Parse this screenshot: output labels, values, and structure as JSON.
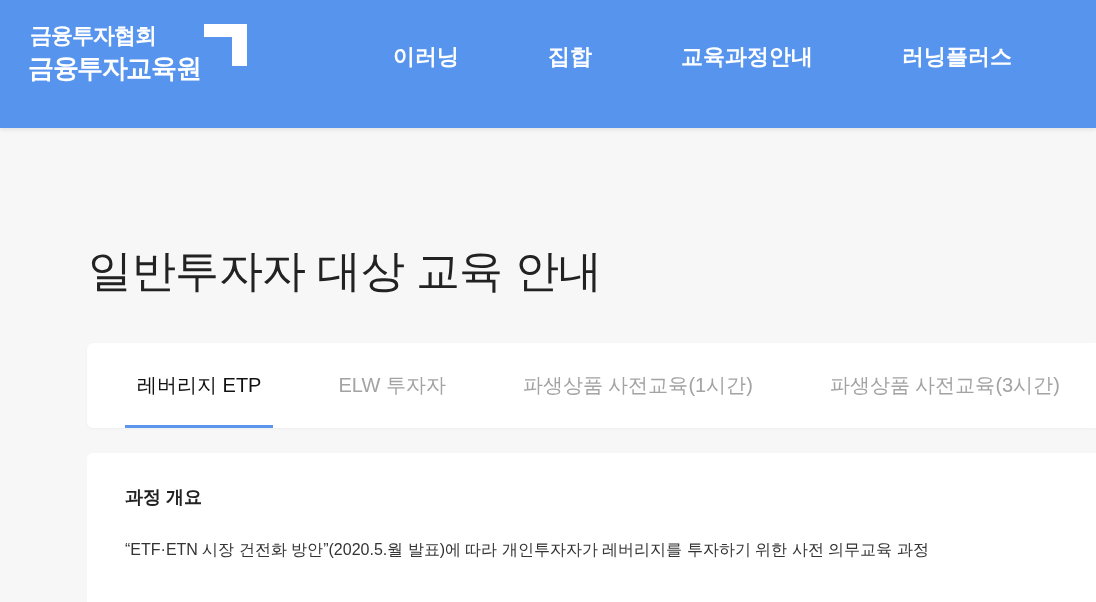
{
  "header": {
    "logo": {
      "line_1": "금융투자협회",
      "line_2": "금융투자교육원"
    },
    "nav": [
      "이러닝",
      "집합",
      "교육과정안내",
      "러닝플러스"
    ]
  },
  "page_title": "일반투자자 대상 교육 안내",
  "tabs": [
    {
      "label": "레버리지 ETP",
      "selected": true
    },
    {
      "label": "ELW 투자자",
      "selected": false
    },
    {
      "label": "파생상품 사전교육(1시간)",
      "selected": false
    },
    {
      "label": "파생상품 사전교육(3시간)",
      "selected": false
    }
  ],
  "section": {
    "title": "과정 개요",
    "text": "“ETF·ETN 시장 건전화 방안”(2020.5.월 발표)에 따라 개인투자자가 레버리지를 투자하기 위한 사전 의무교육 과정"
  }
}
